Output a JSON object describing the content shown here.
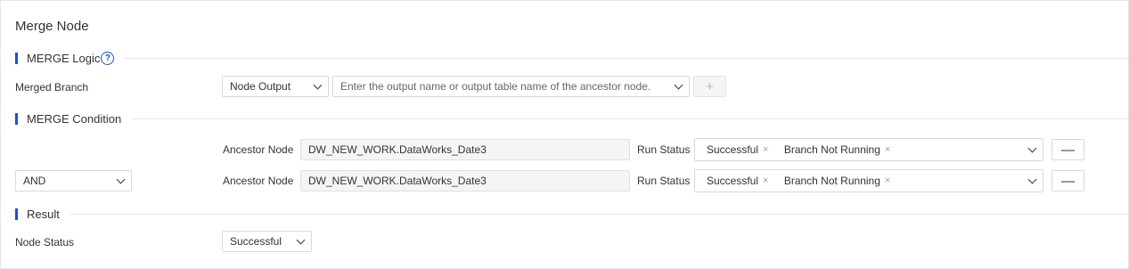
{
  "page": {
    "title": "Merge Node"
  },
  "sections": {
    "logic": {
      "label": "MERGE Logic"
    },
    "condition": {
      "label": "MERGE Condition"
    },
    "result": {
      "label": "Result"
    }
  },
  "merged_branch": {
    "label": "Merged Branch",
    "source_type": "Node Output",
    "output_placeholder": "Enter the output name or output table name of the ancestor node.",
    "add_symbol": "+"
  },
  "conditions": [
    {
      "ancestor_label": "Ancestor Node",
      "ancestor_value": "DW_NEW_WORK.DataWorks_Date3",
      "run_status_label": "Run Status",
      "tags": [
        "Successful",
        "Branch Not Running"
      ],
      "remove_symbol": "—"
    },
    {
      "operator": "AND",
      "ancestor_label": "Ancestor Node",
      "ancestor_value": "DW_NEW_WORK.DataWorks_Date3",
      "run_status_label": "Run Status",
      "tags": [
        "Successful",
        "Branch Not Running"
      ],
      "remove_symbol": "—"
    }
  ],
  "result": {
    "node_status_label": "Node Status",
    "node_status_value": "Successful"
  },
  "icons": {
    "help": "question-circle-icon",
    "dropdown": "chevron-down-icon",
    "tag_close": "close-icon"
  },
  "colors": {
    "accent": "#1f4fd1",
    "border": "#d9d9d9",
    "readonly_bg": "#f5f5f5"
  },
  "glyphs": {
    "help": "?",
    "close": "×"
  }
}
